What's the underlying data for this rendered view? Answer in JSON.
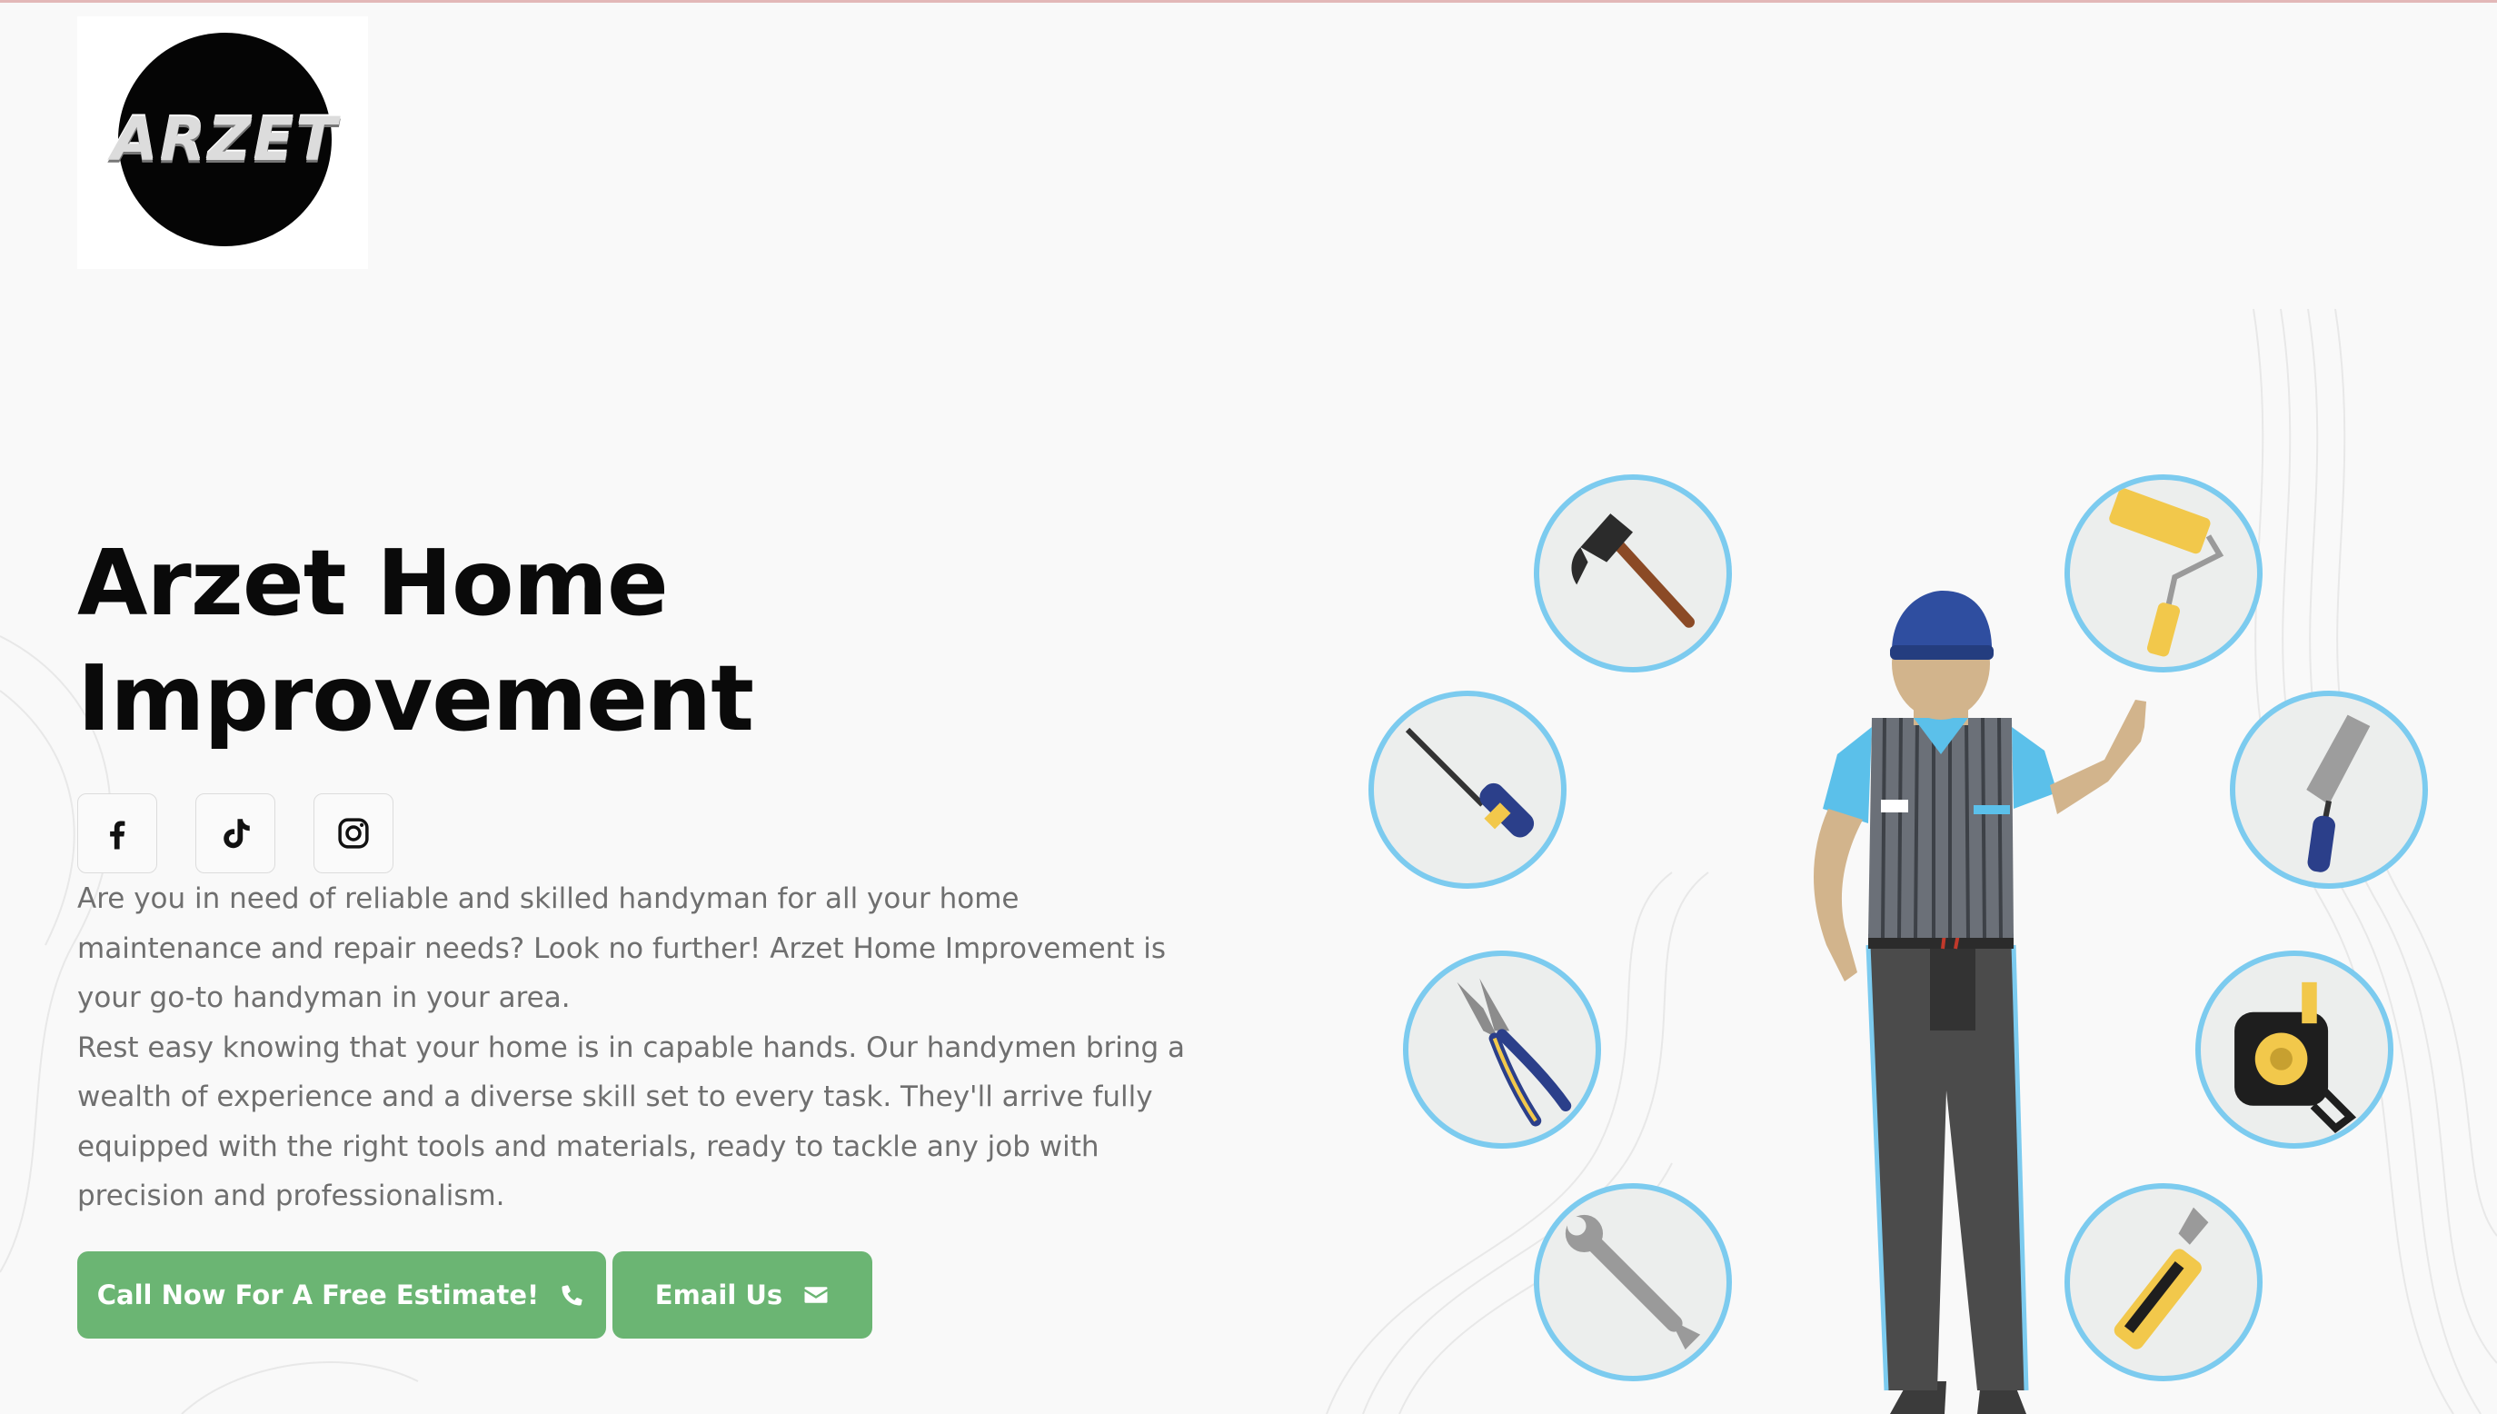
{
  "brand": {
    "logo_text": "ARZET",
    "logo_alt": "Arzet logo"
  },
  "hero": {
    "title_line1": "Arzet Home",
    "title_line2": "Improvement",
    "paragraph1": "Are you in need of reliable and skilled handyman for all your home maintenance and repair needs? Look no further! Arzet Home Improvement is your go-to handyman in your area.",
    "paragraph2": "Rest easy knowing that your home is in capable hands. Our handymen bring a wealth of experience and a diverse skill set to every task. They'll arrive fully equipped with the right tools and materials, ready to tackle any job with precision and professionalism."
  },
  "social": [
    {
      "name": "Facebook",
      "icon": "facebook-icon"
    },
    {
      "name": "TikTok",
      "icon": "tiktok-icon"
    },
    {
      "name": "Instagram",
      "icon": "instagram-icon"
    }
  ],
  "buttons": {
    "call_label": "Call Now For A Free Estimate!",
    "call_icon": "phone-icon",
    "email_label": "Email Us",
    "email_icon": "envelope-icon"
  },
  "illustration": {
    "tools": [
      "hammer-icon",
      "paint-roller-icon",
      "screwdriver-icon",
      "trowel-icon",
      "pliers-icon",
      "tape-measure-icon",
      "wrench-icon",
      "utility-knife-icon"
    ]
  },
  "colors": {
    "accent_green": "#6bb573",
    "circle_border": "#7ccbef",
    "circle_fill": "#eceeed",
    "background": "#f9f9f9",
    "title": "#0a0a0a",
    "body_text": "#6f6f6f"
  }
}
